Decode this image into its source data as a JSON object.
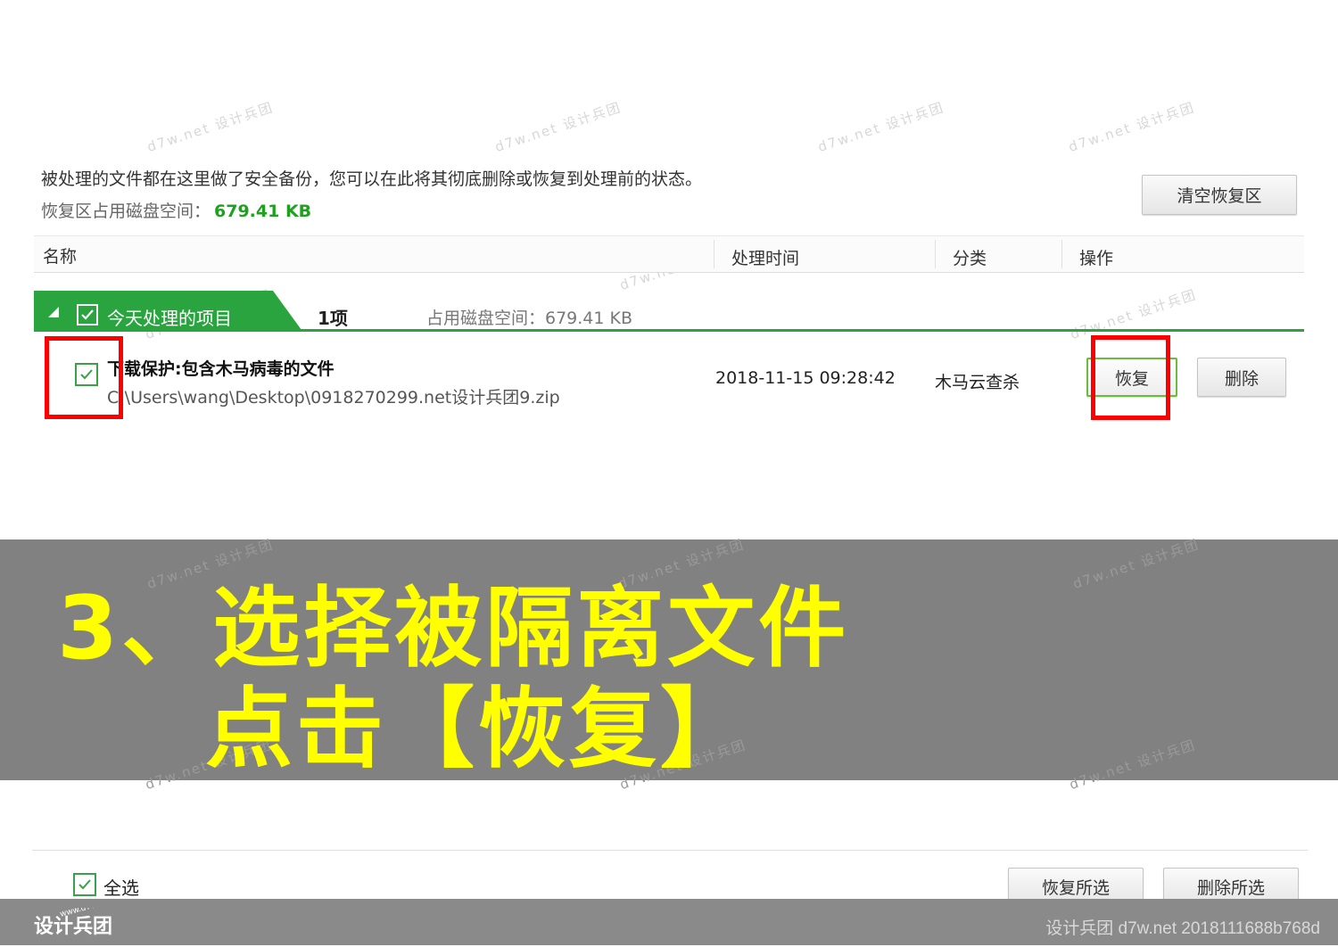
{
  "header": {
    "info_text": "被处理的文件都在这里做了安全备份，您可以在此将其彻底删除或恢复到处理前的状态。",
    "space_label": "恢复区占用磁盘空间：",
    "space_value": "679.41 KB",
    "clear_button": "清空恢复区"
  },
  "table": {
    "columns": [
      "名称",
      "处理时间",
      "分类",
      "操作"
    ]
  },
  "group": {
    "label": "今天处理的项目",
    "count": "1项",
    "space": "占用磁盘空间：679.41 KB",
    "checked": true
  },
  "item": {
    "title": "下载保护:包含木马病毒的文件",
    "path": "C:\\Users\\wang\\Desktop\\0918270299.net设计兵团9.zip",
    "time": "2018-11-15 09:28:42",
    "category": "木马云查杀",
    "restore_label": "恢复",
    "delete_label": "删除",
    "checked": true
  },
  "banner": {
    "line1": "3、选择被隔离文件",
    "line2": "点击【恢复】",
    "text_color": "#ffff00",
    "background": "#818181"
  },
  "footer": {
    "select_all_label": "全选",
    "restore_selected": "恢复所选",
    "delete_selected": "删除所选",
    "credit": "设计兵团 d7w.net 2018111688b768d"
  },
  "watermark": {
    "text": "d7w.net 设计兵团",
    "logo_text": "设计兵团",
    "logo_url_text": "www.d7w.net"
  },
  "colors": {
    "accent_green": "#2aa43e",
    "value_green": "#20a020",
    "highlight_red": "#ff0000"
  }
}
